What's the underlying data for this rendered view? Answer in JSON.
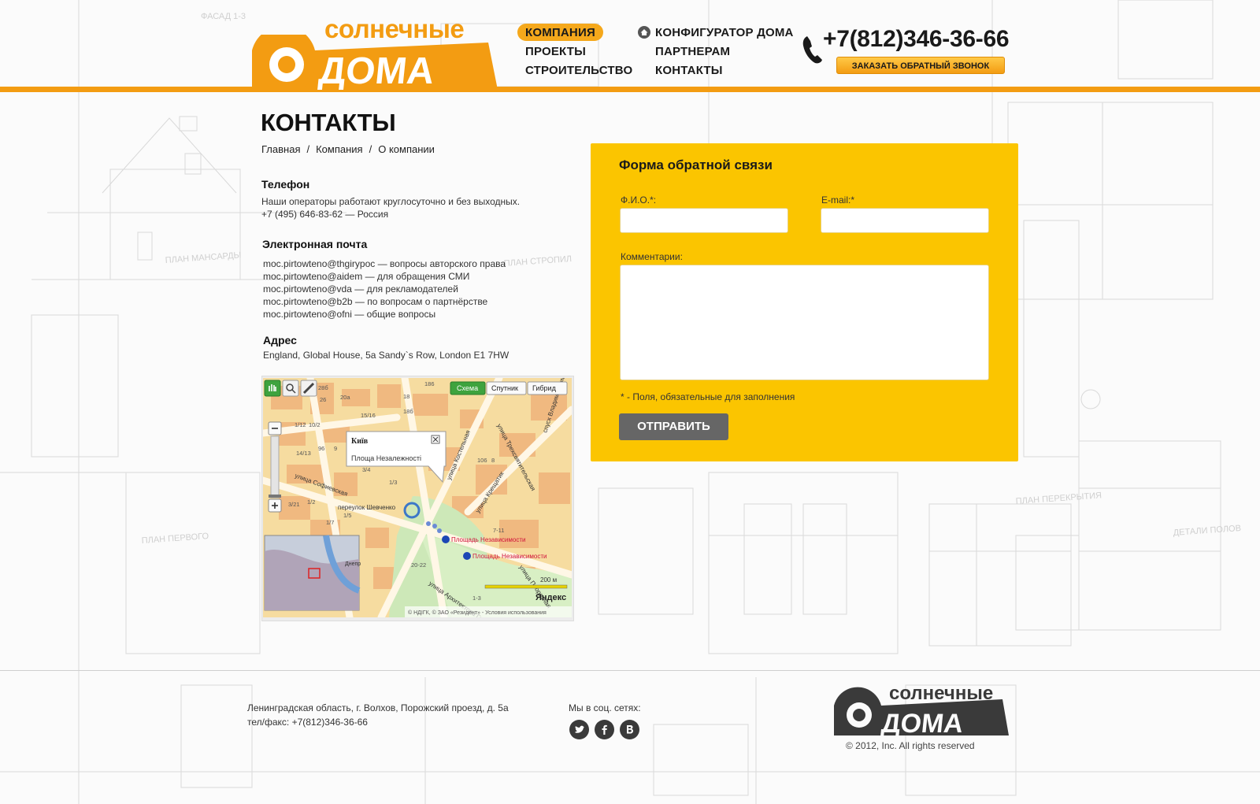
{
  "brand": {
    "logo_small": "солнечные",
    "logo_big": "ДОМА"
  },
  "nav": {
    "company": "КОМПАНИЯ",
    "projects": "ПРОЕКТЫ",
    "construction": "СТРОИТЕЛЬСТВО",
    "configurator": "КОНФИГУРАТОР ДОМА",
    "partners": "ПАРТНЕРАМ",
    "contacts": "КОНТАКТЫ"
  },
  "header": {
    "phone": "+7(812)346-36-66",
    "callback_label": "ЗАКАЗАТЬ ОБРАТНЫЙ ЗВОНОК"
  },
  "page": {
    "title": "КОНТАКТЫ",
    "breadcrumb": [
      "Главная",
      "Компания",
      "О компании"
    ],
    "breadcrumb_sep": "/"
  },
  "contacts": {
    "phone_title": "Телефон",
    "phone_lines": [
      "Наши операторы работают круглосуточно и без выходных.",
      "+7 (495) 646-83-62 — Россия"
    ],
    "email_title": "Электронная почта",
    "email_lines": [
      "moc.pirtowteno@thgirypoc — вопросы авторского права",
      "moc.pirtowteno@aidem — для обращения СМИ",
      "moc.pirtowteno@vda — для рекламодателей",
      "moc.pirtowteno@b2b — по вопросам о партнёрстве",
      "moc.pirtowteno@ofni — общие вопросы"
    ],
    "address_title": "Адрес",
    "address": "England, Global House, 5a Sandy`s Row, London E1 7HW"
  },
  "map": {
    "tab_scheme": "Схема",
    "tab_satellite": "Спутник",
    "tab_hybrid": "Гибрид",
    "balloon_title": "Київ",
    "balloon_text": "Площа Незалежності",
    "scale": "200 м",
    "brand": "Яндекс",
    "copyright": "© НДІГК, © ЗАО «Резидент» - Условия использования",
    "metro_1": "Площадь Независимости",
    "metro_2": "Площадь Независимости",
    "streets": [
      "улица Костельная",
      "улица Трехсвятительская",
      "улица Софиевская",
      "переулок Шевченко",
      "улица Крещатик",
      "улица Архитектора Городецкого",
      "спуск Владимирский",
      "улица Прорезная",
      "Днепр"
    ],
    "house_numbers": [
      "28б",
      "26",
      "20а",
      "18",
      "18б",
      "186",
      "15/16",
      "1/12",
      "10/2",
      "14/13",
      "96",
      "9",
      "3/4",
      "1/3",
      "106",
      "8",
      "3/21",
      "1/2",
      "1/7",
      "1/5",
      "7-11",
      "20-22",
      "1-3"
    ]
  },
  "form": {
    "title": "Форма обратной связи",
    "name_label": "Ф.И.О.*:",
    "email_label": "E-mail:*",
    "comment_label": "Комментарии:",
    "name_value": "",
    "email_value": "",
    "comment_value": "",
    "note": "* - Поля, обязательные для заполнения",
    "submit": "ОТПРАВИТЬ"
  },
  "footer": {
    "address": "Ленинградская область, г. Волхов, Порожский проезд, д. 5а",
    "phone": "тел/факс: +7(812)346-36-66",
    "social_label": "Мы в соц. сетях:",
    "social_icons": [
      "twitter-icon",
      "facebook-icon",
      "vkontakte-icon"
    ],
    "copyright": "© 2012, Inc. All rights reserved"
  },
  "colors": {
    "accent": "#f39c12",
    "form_bg": "#fbc500",
    "button": "#666666"
  }
}
